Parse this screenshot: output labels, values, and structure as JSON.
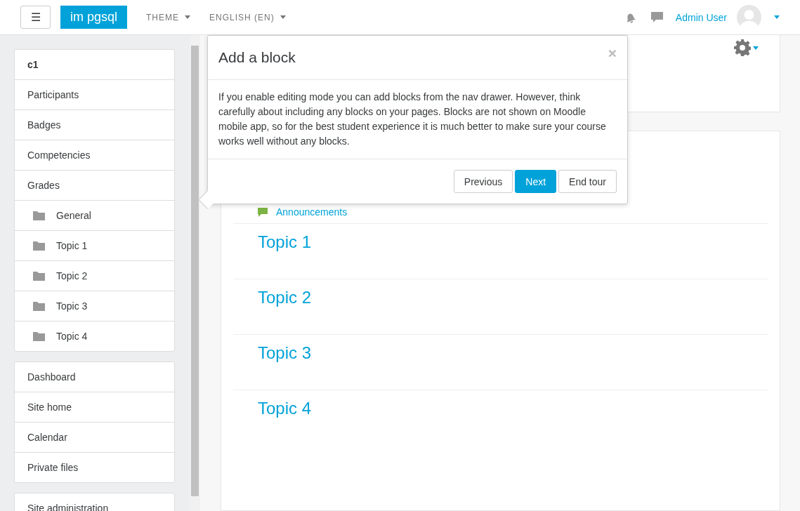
{
  "navbar": {
    "menu_button": "☰",
    "site_name": "im pgsql",
    "menus": [
      {
        "label": "THEME"
      },
      {
        "label": "ENGLISH (EN)"
      }
    ],
    "user_name": "Admin User"
  },
  "drawer": {
    "course_nav": [
      {
        "label": "c1",
        "kind": "heading"
      },
      {
        "label": "Participants",
        "kind": "link"
      },
      {
        "label": "Badges",
        "kind": "link"
      },
      {
        "label": "Competencies",
        "kind": "link"
      },
      {
        "label": "Grades",
        "kind": "link"
      },
      {
        "label": "General",
        "kind": "section"
      },
      {
        "label": "Topic 1",
        "kind": "section"
      },
      {
        "label": "Topic 2",
        "kind": "section"
      },
      {
        "label": "Topic 3",
        "kind": "section"
      },
      {
        "label": "Topic 4",
        "kind": "section"
      }
    ],
    "site_nav": [
      {
        "label": "Dashboard",
        "kind": "link"
      },
      {
        "label": "Site home",
        "kind": "link"
      },
      {
        "label": "Calendar",
        "kind": "link"
      },
      {
        "label": "Private files",
        "kind": "link"
      }
    ],
    "admin_nav": [
      {
        "label": "Site administration",
        "kind": "link"
      }
    ]
  },
  "course": {
    "sections": [
      {
        "activities": [
          {
            "label": "Announcements"
          }
        ]
      },
      {
        "title": "Topic 1"
      },
      {
        "title": "Topic 2"
      },
      {
        "title": "Topic 3"
      },
      {
        "title": "Topic 4"
      }
    ]
  },
  "tour": {
    "title": "Add a block",
    "close": "×",
    "body": "If you enable editing mode you can add blocks from the nav drawer. However, think carefully about including any blocks on your pages. Blocks are not shown on Moodle mobile app, so for the best student experience it is much better to make sure your course works well without any blocks.",
    "buttons": [
      {
        "label": "Previous",
        "primary": false
      },
      {
        "label": "Next",
        "primary": true
      },
      {
        "label": "End tour",
        "primary": false
      }
    ]
  }
}
